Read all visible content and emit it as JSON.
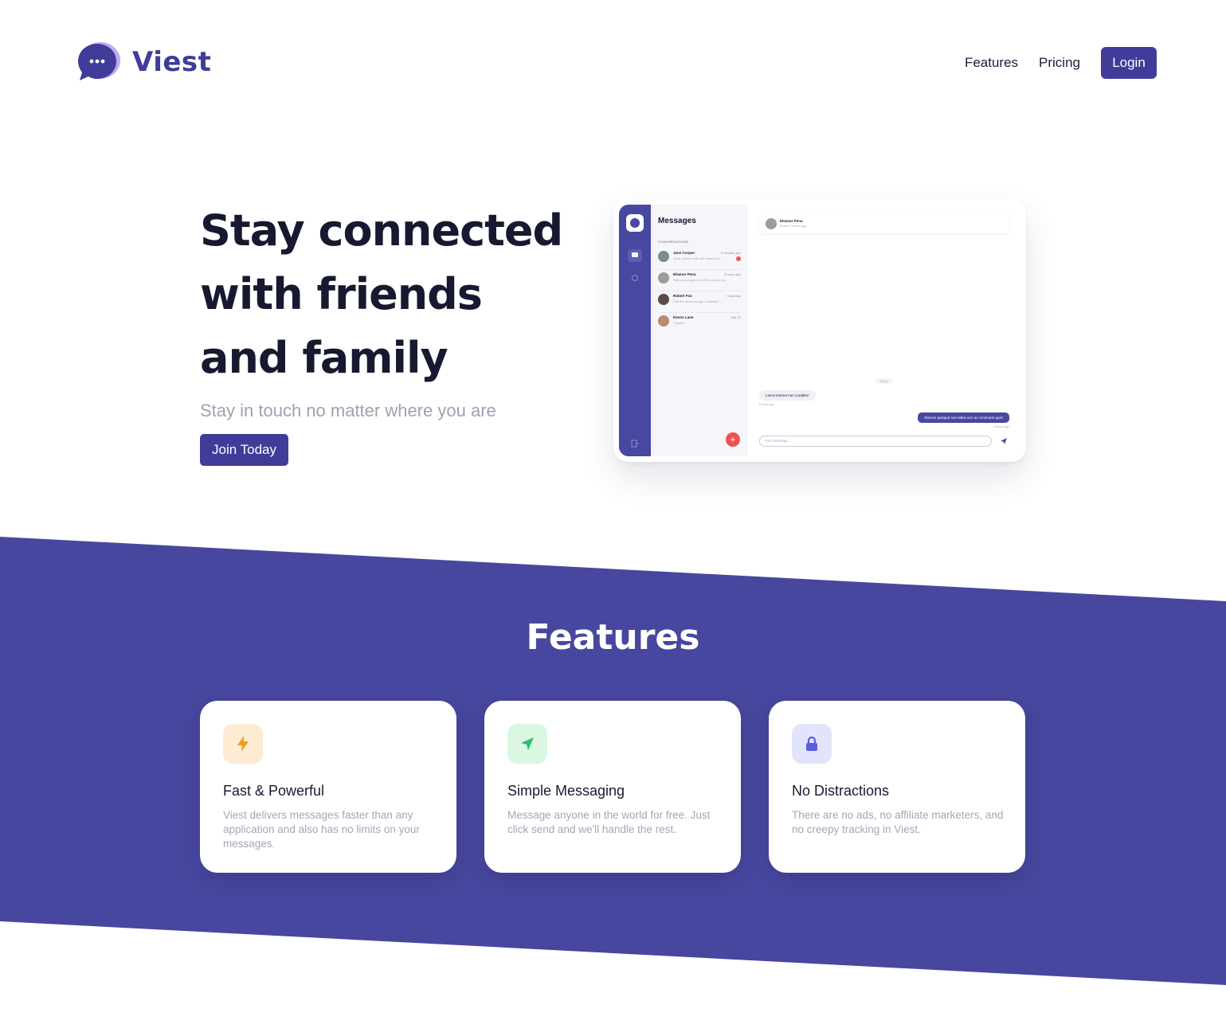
{
  "brand": {
    "name": "Viest",
    "accent": "#3f3d99",
    "band_color": "#47479f"
  },
  "nav": {
    "links": [
      "Features",
      "Pricing"
    ],
    "login_label": "Login"
  },
  "hero": {
    "title": "Stay connected with friends and family",
    "subtitle": "Stay in touch no matter where you are",
    "cta_label": "Join Today"
  },
  "mockup": {
    "title": "Messages",
    "section_label": "CONVERSATIONS",
    "conversations": [
      {
        "name": "Jane Cooper",
        "preview": "Amet minim mollit non deserunt u...",
        "time": "8 minutes ago",
        "unread": true
      },
      {
        "name": "Eleanor Pena",
        "preview": "Rutrum quisque non tellus orci ac co...",
        "time": "8 hours ago",
        "unread": false
      },
      {
        "name": "Robert Fox",
        "preview": "Call me when you get a chance!",
        "time": "Yesterday",
        "unread": false
      },
      {
        "name": "Devon Lane",
        "preview": "Thanks!",
        "time": "Mar 23",
        "unread": false
      }
    ],
    "chat_header": {
      "name": "Eleanor Pena",
      "status": "Active 5 hours ago"
    },
    "day_divider": "Today",
    "incoming": {
      "text": "Lacus laoreet non curabitur",
      "time": "8 hours ago"
    },
    "outgoing": {
      "text": "Rutrum quisque non tellus orci ac commodo quis!",
      "time": "8 hours ago"
    },
    "input_placeholder": "Your message..."
  },
  "features": {
    "title": "Features",
    "cards": [
      {
        "icon": "lightning-icon",
        "icon_bg": "#fdebd3",
        "icon_color": "#f0a020",
        "title": "Fast & Powerful",
        "desc": "Viest delivers messages faster than any application and also has no limits on your messages."
      },
      {
        "icon": "paper-plane-icon",
        "icon_bg": "#dcf6e4",
        "icon_color": "#2fbf6a",
        "title": "Simple Messaging",
        "desc": "Message anyone in the world for free. Just click send and we'll handle the rest."
      },
      {
        "icon": "lock-icon",
        "icon_bg": "#e2e4fb",
        "icon_color": "#5b5ee0",
        "title": "No Distractions",
        "desc": "There are no ads, no affiliate marketers, and no creepy tracking in Viest."
      }
    ]
  }
}
